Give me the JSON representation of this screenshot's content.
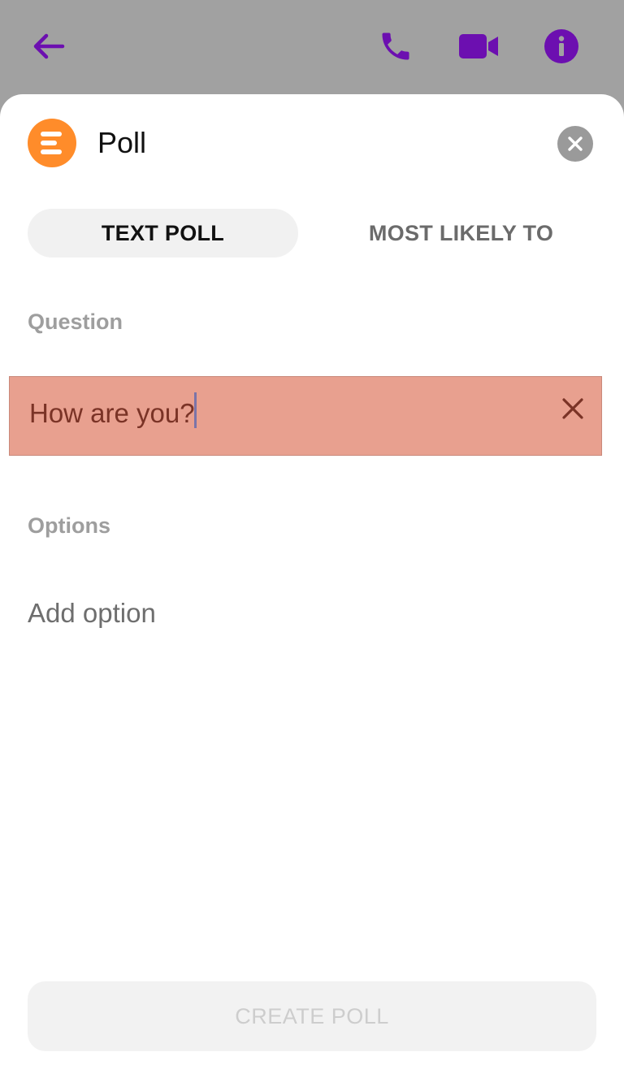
{
  "appbar": {
    "icons": [
      "arrow-left-icon",
      "phone-icon",
      "video-camera-icon",
      "info-icon"
    ],
    "accent_color": "#6c0fb0"
  },
  "sheet": {
    "title": "Poll",
    "logo_color": "#ff8c2a",
    "close_icon": "close-icon"
  },
  "tabs": [
    {
      "label": "TEXT POLL",
      "active": true
    },
    {
      "label": "MOST LIKELY TO",
      "active": false
    }
  ],
  "question": {
    "label": "Question",
    "value": "How are you?",
    "clear_icon": "x-icon"
  },
  "options": {
    "label": "Options",
    "add_placeholder": "Add option"
  },
  "actions": {
    "create_label": "CREATE POLL"
  }
}
